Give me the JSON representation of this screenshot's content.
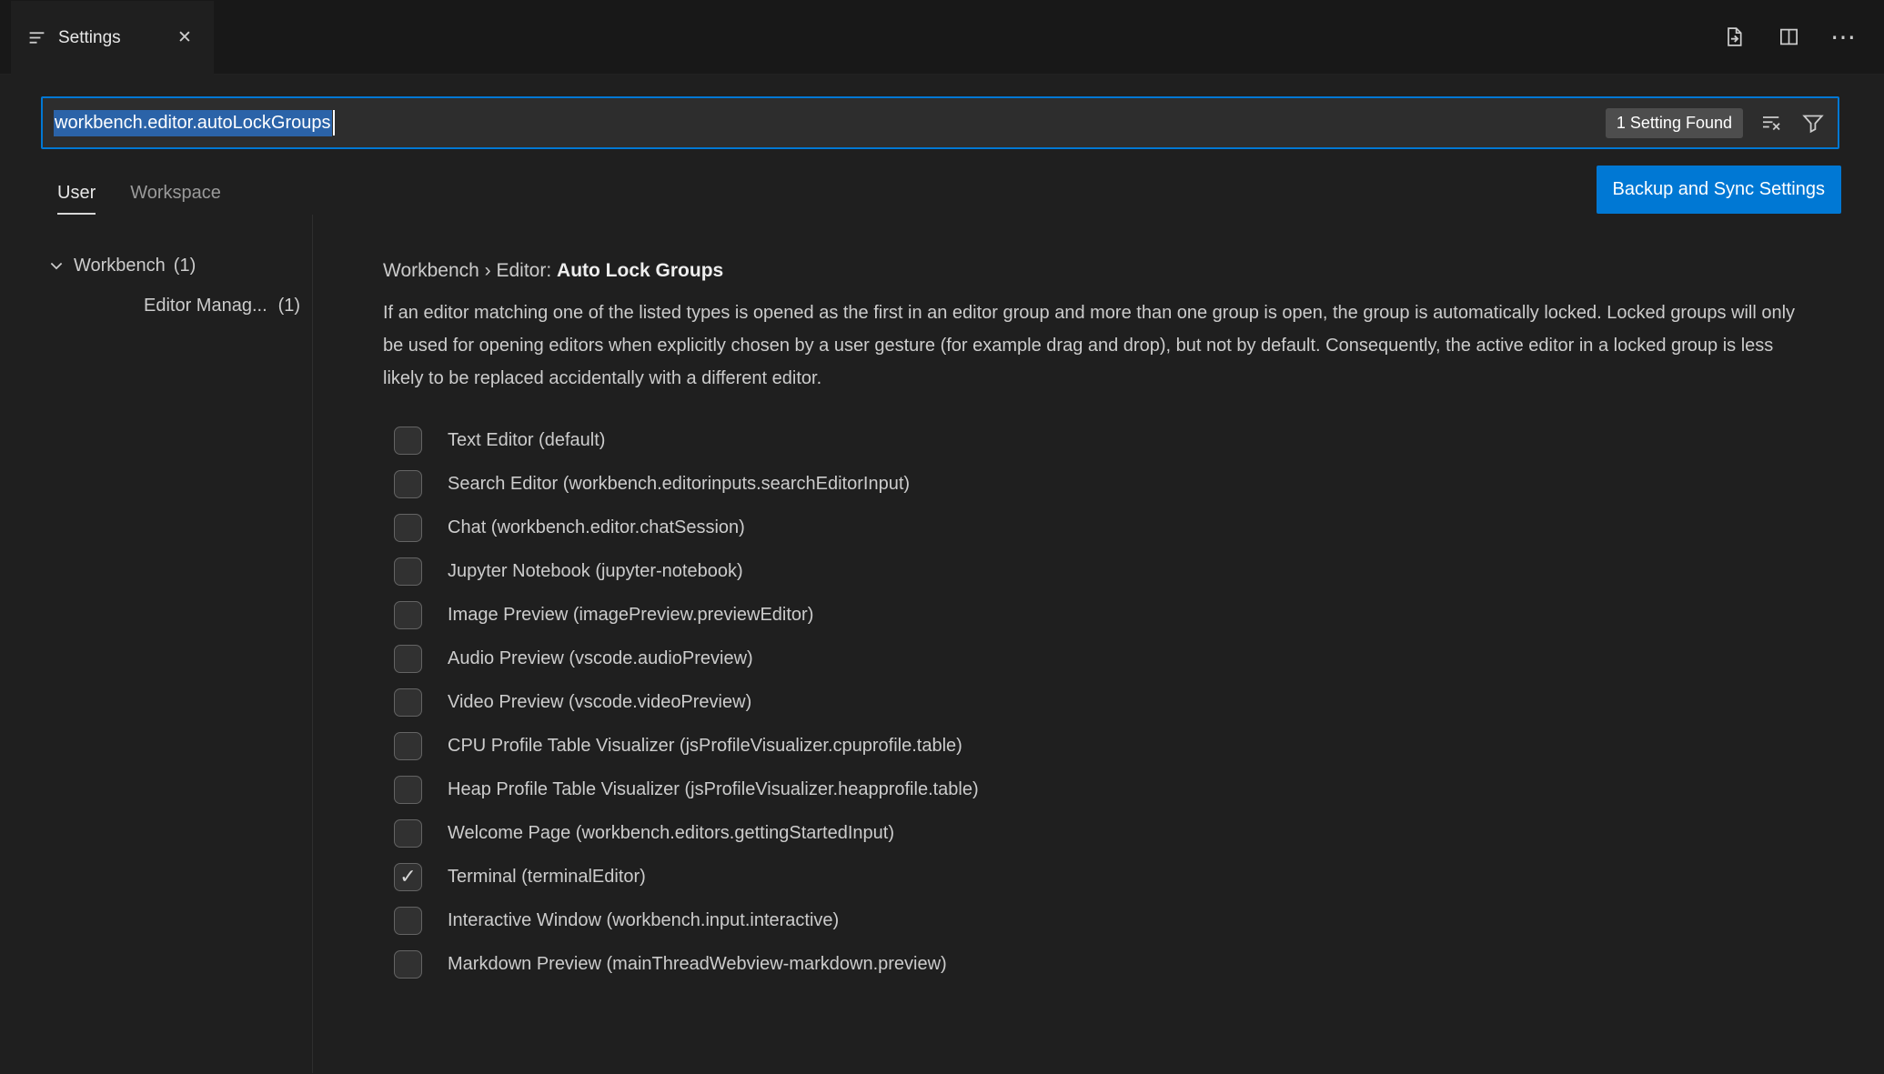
{
  "window": {
    "tab_title": "Settings"
  },
  "icons": {
    "close": "✕",
    "more_actions": "⋯",
    "check": "✓"
  },
  "colors": {
    "accent": "#0078d4",
    "input_selection": "#2b63a8",
    "background": "#1f1f1f",
    "tabbar_background": "#181818",
    "badge_background": "#4d4d4d"
  },
  "search": {
    "value": "workbench.editor.autoLockGroups",
    "results_badge": "1 Setting Found"
  },
  "scope_tabs": [
    {
      "label": "User",
      "active": true
    },
    {
      "label": "Workspace",
      "active": false
    }
  ],
  "backup_button": "Backup and Sync Settings",
  "tree": {
    "items": [
      {
        "label": "Workbench",
        "count": "(1)",
        "level": 0,
        "expanded": true
      },
      {
        "label": "Editor Manag...",
        "count": "(1)",
        "level": 1
      }
    ]
  },
  "setting": {
    "breadcrumb_prefix": "Workbench › Editor: ",
    "title": "Auto Lock Groups",
    "description": "If an editor matching one of the listed types is opened as the first in an editor group and more than one group is open, the group is automatically locked. Locked groups will only be used for opening editors when explicitly chosen by a user gesture (for example drag and drop), but not by default. Consequently, the active editor in a locked group is less likely to be replaced accidentally with a different editor.",
    "options": [
      {
        "label": "Text Editor (default)",
        "checked": false
      },
      {
        "label": "Search Editor (workbench.editorinputs.searchEditorInput)",
        "checked": false
      },
      {
        "label": "Chat (workbench.editor.chatSession)",
        "checked": false
      },
      {
        "label": "Jupyter Notebook (jupyter-notebook)",
        "checked": false
      },
      {
        "label": "Image Preview (imagePreview.previewEditor)",
        "checked": false
      },
      {
        "label": "Audio Preview (vscode.audioPreview)",
        "checked": false
      },
      {
        "label": "Video Preview (vscode.videoPreview)",
        "checked": false
      },
      {
        "label": "CPU Profile Table Visualizer (jsProfileVisualizer.cpuprofile.table)",
        "checked": false
      },
      {
        "label": "Heap Profile Table Visualizer (jsProfileVisualizer.heapprofile.table)",
        "checked": false
      },
      {
        "label": "Welcome Page (workbench.editors.gettingStartedInput)",
        "checked": false
      },
      {
        "label": "Terminal (terminalEditor)",
        "checked": true
      },
      {
        "label": "Interactive Window (workbench.input.interactive)",
        "checked": false
      },
      {
        "label": "Markdown Preview (mainThreadWebview-markdown.preview)",
        "checked": false
      }
    ]
  }
}
